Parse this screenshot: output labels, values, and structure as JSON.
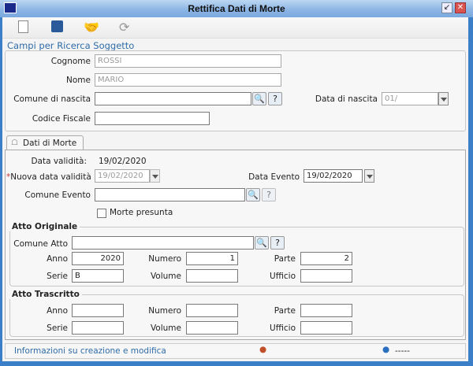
{
  "window": {
    "title": "Rettifica Dati di Morte"
  },
  "toolbar": {
    "icons": [
      "new-document-icon",
      "save-icon",
      "handshake-icon",
      "refresh-icon"
    ]
  },
  "search": {
    "title": "Campi per Ricerca Soggetto",
    "cognome_label": "Cognome",
    "cognome": "ROSSI",
    "nome_label": "Nome",
    "nome": "MARIO",
    "comune_nascita_label": "Comune di nascita",
    "comune_nascita": "",
    "data_nascita_label": "Data di nascita",
    "data_nascita": "01/",
    "codice_fiscale_label": "Codice Fiscale",
    "codice_fiscale": ""
  },
  "tab": {
    "label": "Dati di Morte",
    "data_validita_label": "Data validità:",
    "data_validita": "19/02/2020",
    "required_mark": "*",
    "nuova_data_label": "Nuova data validità",
    "nuova_data": "19/02/2020",
    "data_evento_label": "Data Evento",
    "data_evento": "19/02/2020",
    "comune_evento_label": "Comune Evento",
    "comune_evento": "",
    "morte_presunta_label": "Morte presunta",
    "morte_presunta": false
  },
  "atto_originale": {
    "title": "Atto Originale",
    "comune_label": "Comune Atto",
    "comune": "",
    "anno_label": "Anno",
    "anno": "2020",
    "numero_label": "Numero",
    "numero": "1",
    "parte_label": "Parte",
    "parte": "2",
    "serie_label": "Serie",
    "serie": "B",
    "volume_label": "Volume",
    "volume": "",
    "ufficio_label": "Ufficio",
    "ufficio": ""
  },
  "atto_trascritto": {
    "title": "Atto Trascritto",
    "anno_label": "Anno",
    "anno": "",
    "numero_label": "Numero",
    "numero": "",
    "parte_label": "Parte",
    "parte": "",
    "serie_label": "Serie",
    "serie": "",
    "volume_label": "Volume",
    "volume": "",
    "ufficio_label": "Ufficio",
    "ufficio": ""
  },
  "status": {
    "info": "Informazioni su creazione e modifica",
    "modified_by": "-----"
  }
}
